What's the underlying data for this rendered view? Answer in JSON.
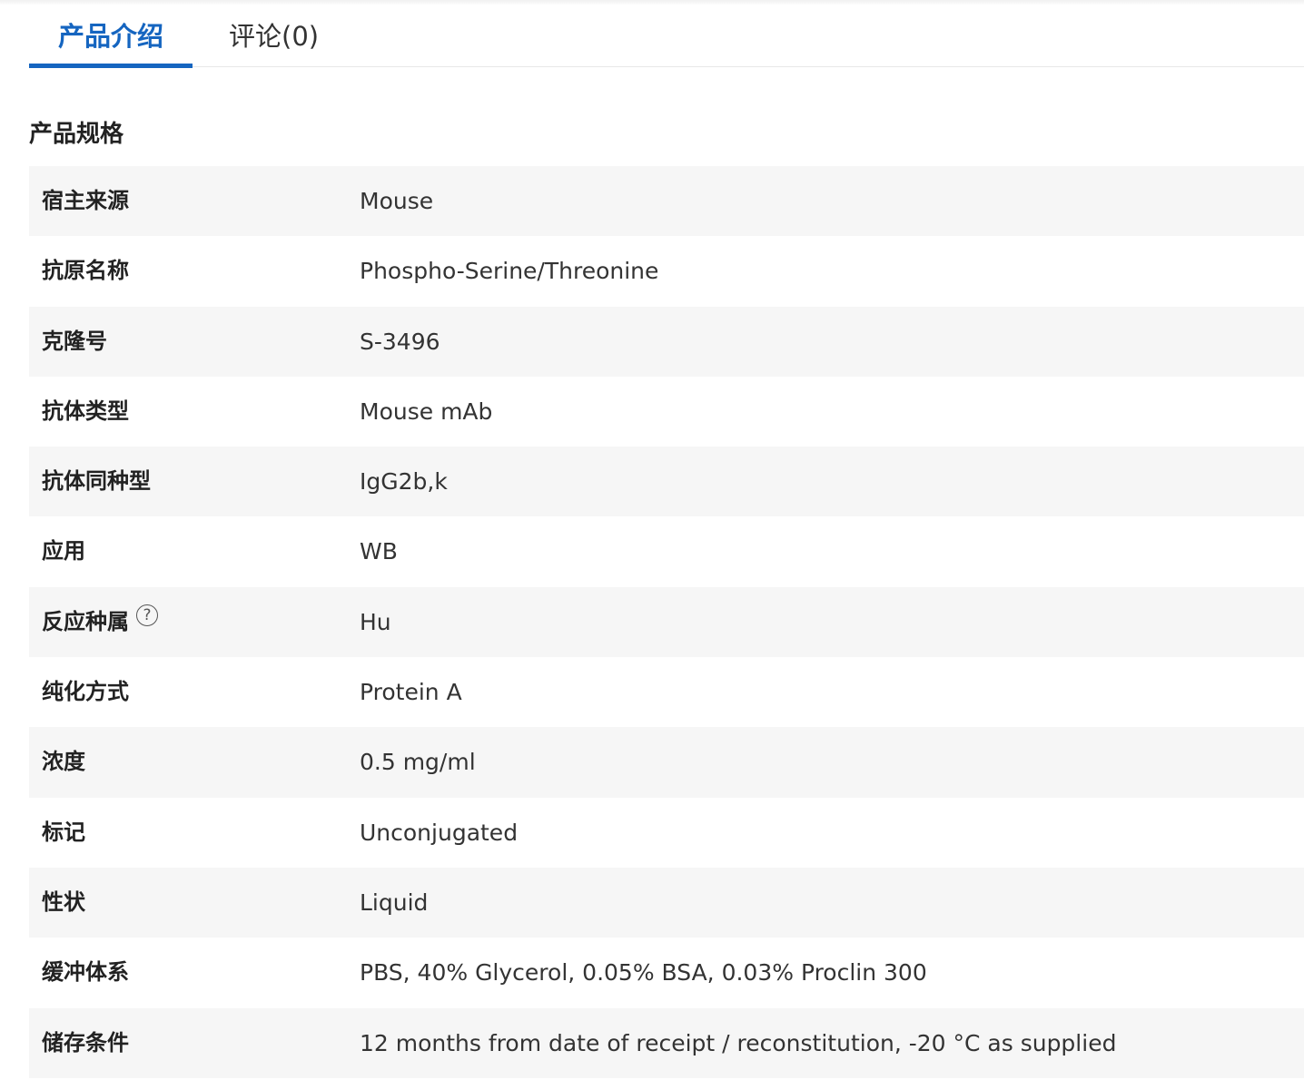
{
  "tabs": {
    "intro": "产品介绍",
    "comments": "评论(0)",
    "active": "intro"
  },
  "section_title": "产品规格",
  "specs": [
    {
      "label": "宿主来源",
      "value": "Mouse"
    },
    {
      "label": "抗原名称",
      "value": "Phospho-Serine/Threonine"
    },
    {
      "label": "克隆号",
      "value": "S-3496"
    },
    {
      "label": "抗体类型",
      "value": "Mouse mAb"
    },
    {
      "label": "抗体同种型",
      "value": "IgG2b,k"
    },
    {
      "label": "应用",
      "value": "WB"
    },
    {
      "label": "反应种属",
      "value": "Hu",
      "help_icon": "?"
    },
    {
      "label": "纯化方式",
      "value": "Protein A"
    },
    {
      "label": "浓度",
      "value": "0.5 mg/ml"
    },
    {
      "label": "标记",
      "value": "Unconjugated"
    },
    {
      "label": "性状",
      "value": "Liquid"
    },
    {
      "label": "缓冲体系",
      "value": "PBS, 40% Glycerol, 0.05% BSA, 0.03% Proclin 300"
    },
    {
      "label": "储存条件",
      "value": "12 months from date of receipt / reconstitution, -20 °C as supplied"
    }
  ],
  "colors": {
    "accent": "#1565c0",
    "row_shade": "#f6f6f6"
  }
}
